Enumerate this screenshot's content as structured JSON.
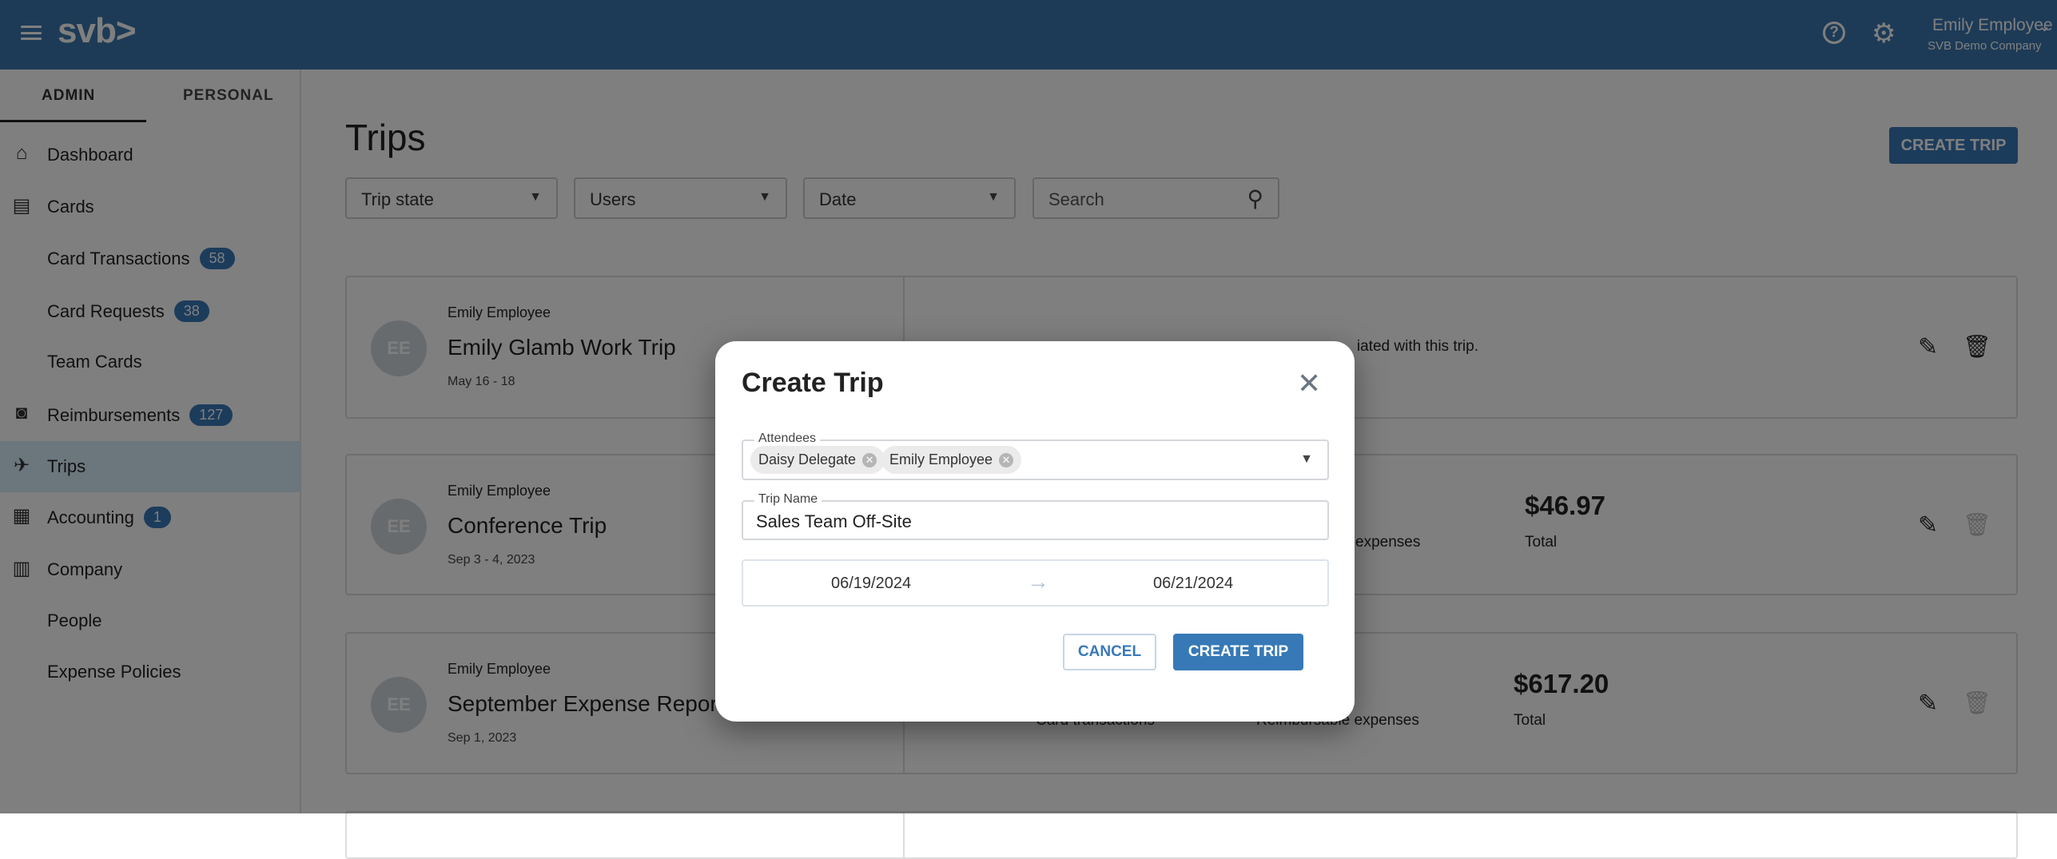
{
  "header": {
    "logo": "svb>",
    "user_name": "Emily Employee",
    "company": "SVB Demo Company",
    "help_icon": "question-circle-icon",
    "settings_icon": "gear-icon"
  },
  "sidebar": {
    "tabs": [
      {
        "label": "ADMIN",
        "active": true
      },
      {
        "label": "PERSONAL",
        "active": false
      }
    ],
    "items": [
      {
        "label": "Dashboard",
        "icon": "home-icon",
        "glyph": "⌂"
      },
      {
        "label": "Cards",
        "icon": "cards-icon",
        "glyph": "▤"
      },
      {
        "label": "Card Transactions",
        "badge": "58"
      },
      {
        "label": "Card Requests",
        "badge": "38"
      },
      {
        "label": "Team Cards"
      },
      {
        "label": "Reimbursements",
        "badge": "127",
        "icon": "money-icon",
        "glyph": "◙"
      },
      {
        "label": "Trips",
        "icon": "airplane-icon",
        "glyph": "✈",
        "active": true
      },
      {
        "label": "Accounting",
        "badge": "1",
        "icon": "calculator-icon",
        "glyph": "▦"
      },
      {
        "label": "Company",
        "icon": "building-icon",
        "glyph": "▥"
      },
      {
        "label": "People"
      },
      {
        "label": "Expense Policies"
      }
    ]
  },
  "main": {
    "title": "Trips",
    "create_trip_label": "CREATE TRIP",
    "filters": {
      "trip_state": "Trip state",
      "users": "Users",
      "date": "Date",
      "search_placeholder": "Search"
    },
    "trips": [
      {
        "initials": "EE",
        "owner": "Emily Employee",
        "name": "Emily Glamb Work Trip",
        "dates": "May 16 - 18",
        "message": "iated with this trip."
      },
      {
        "initials": "EE",
        "owner": "Emily Employee",
        "name": "Conference Trip",
        "dates": "Sep 3 - 4, 2023",
        "reimb_label": "expenses",
        "total": "$46.97",
        "total_label": "Total"
      },
      {
        "initials": "EE",
        "owner": "Emily Employee",
        "name": "September Expense Report",
        "dates": "Sep 1, 2023",
        "card_label": "Card transactions",
        "reimb_label": "Reimbursable expenses",
        "total": "$617.20",
        "total_label": "Total"
      }
    ]
  },
  "modal": {
    "title": "Create Trip",
    "attendees_label": "Attendees",
    "attendees": [
      "Daisy Delegate",
      "Emily Employee"
    ],
    "trip_name_label": "Trip Name",
    "trip_name_value": "Sales Team Off-Site",
    "start_date": "06/19/2024",
    "end_date": "06/21/2024",
    "cancel_label": "CANCEL",
    "create_label": "CREATE TRIP"
  },
  "colors": {
    "brand": "#3a76ae",
    "primary_button": "#3679b6",
    "badge": "#3979b8",
    "active_nav": "#d6ecfb"
  }
}
